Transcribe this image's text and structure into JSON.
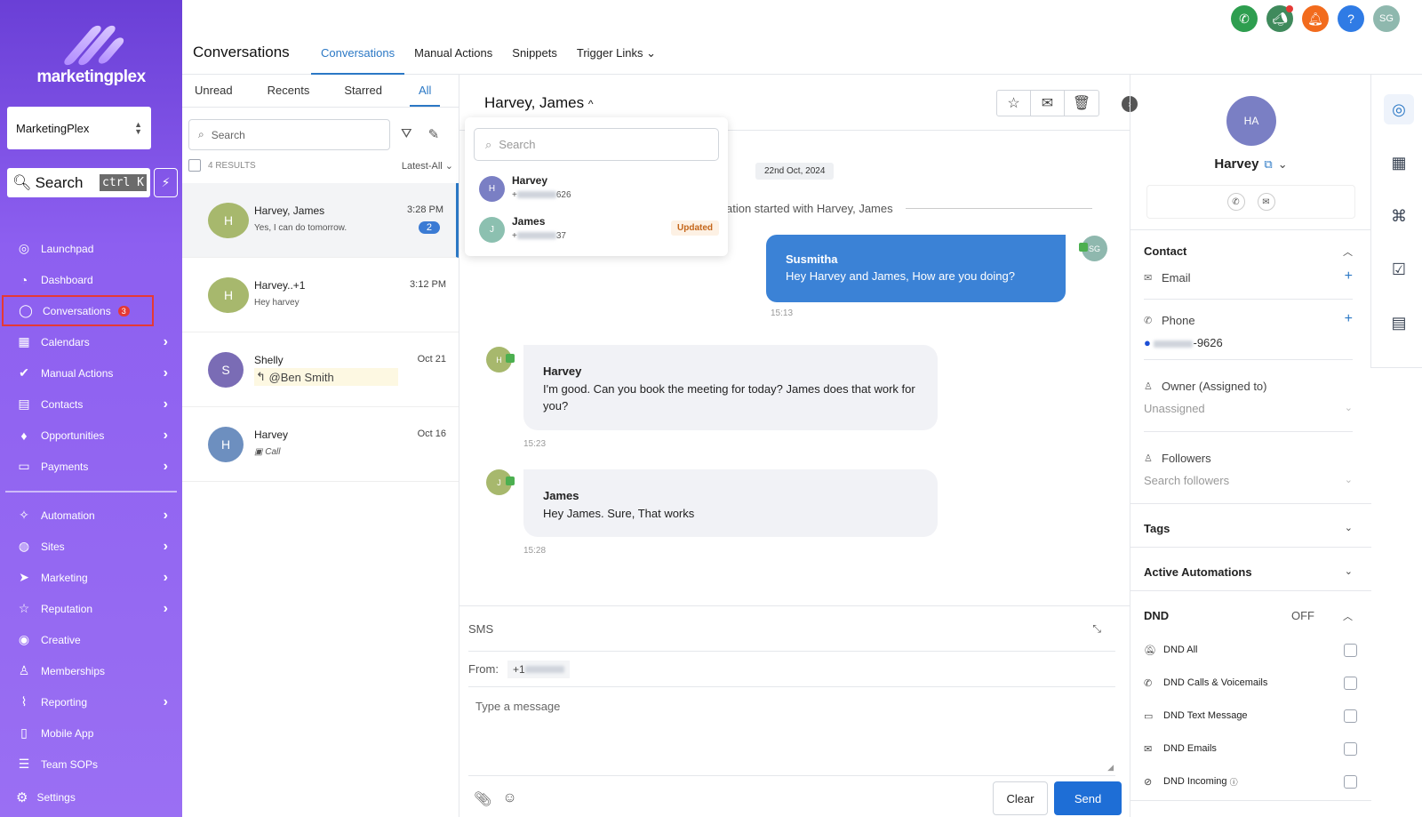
{
  "sidebar": {
    "brand": "marketingplex",
    "account": "MarketingPlex",
    "search_placeholder": "Search",
    "search_shortcut": "ctrl K",
    "items": [
      {
        "label": "Launchpad",
        "icon": "rocket-icon"
      },
      {
        "label": "Dashboard",
        "icon": "dashboard-icon"
      },
      {
        "label": "Conversations",
        "icon": "chat-icon",
        "badge": "3"
      },
      {
        "label": "Calendars",
        "icon": "calendar-icon"
      },
      {
        "label": "Manual Actions",
        "icon": "check-circle-icon"
      },
      {
        "label": "Contacts",
        "icon": "contact-book-icon"
      },
      {
        "label": "Opportunities",
        "icon": "fire-icon"
      },
      {
        "label": "Payments",
        "icon": "card-icon"
      },
      {
        "label": "Automation",
        "icon": "wand-icon"
      },
      {
        "label": "Sites",
        "icon": "globe-icon"
      },
      {
        "label": "Marketing",
        "icon": "send-icon"
      },
      {
        "label": "Reputation",
        "icon": "star-icon"
      },
      {
        "label": "Creative",
        "icon": "palette-icon"
      },
      {
        "label": "Memberships",
        "icon": "badge-icon"
      },
      {
        "label": "Reporting",
        "icon": "chart-icon"
      },
      {
        "label": "Mobile App",
        "icon": "phone-icon"
      },
      {
        "label": "Team SOPs",
        "icon": "list-icon"
      }
    ],
    "settings": "Settings"
  },
  "header": {
    "title": "Conversations",
    "tabs": [
      "Conversations",
      "Manual Actions",
      "Snippets",
      "Trigger Links"
    ],
    "user_initials": "SG"
  },
  "list": {
    "tabs": [
      "Unread",
      "Recents",
      "Starred",
      "All"
    ],
    "search_placeholder": "Search",
    "results": "4 RESULTS",
    "sort": "Latest-All",
    "conversations": [
      {
        "initial": "H",
        "name": "Harvey, James",
        "preview": "Yes, I can do tomorrow.",
        "time": "3:28 PM",
        "unread": "2"
      },
      {
        "initial": "H",
        "name": "Harvey..+1",
        "preview": "Hey harvey",
        "time": "3:12 PM"
      },
      {
        "initial": "S",
        "name": "Shelly",
        "preview": "@Ben Smith",
        "time": "Oct 21"
      },
      {
        "initial": "H",
        "name": "Harvey",
        "preview": "Call",
        "time": "Oct 16"
      }
    ]
  },
  "chat": {
    "title": "Harvey, James",
    "date": "22nd Oct, 2024",
    "started": "ation started with Harvey, James",
    "messages": [
      {
        "sender": "Susmitha",
        "text": "Hey Harvey and James, How are you doing?",
        "time": "15:13",
        "initials": "SG"
      },
      {
        "sender": "Harvey",
        "text": "I'm good. Can you book the meeting for today? James does that work for you?",
        "time": "15:23",
        "initials": "H"
      },
      {
        "sender": "James",
        "text": "Hey James. Sure, That works",
        "time": "15:28",
        "initials": "J"
      }
    ],
    "dropdown": {
      "search_placeholder": "Search",
      "participants": [
        {
          "initial": "H",
          "name": "Harvey",
          "phone_prefix": "+",
          "phone_suffix": "626"
        },
        {
          "initial": "J",
          "name": "James",
          "phone_prefix": "+",
          "phone_suffix": "37",
          "tag": "Updated"
        }
      ]
    },
    "composer": {
      "channel": "SMS",
      "from_label": "From:",
      "from_value": "+1",
      "placeholder": "Type a message",
      "clear": "Clear",
      "send": "Send"
    }
  },
  "contact": {
    "initials": "HA",
    "name": "Harvey",
    "section_contact": "Contact",
    "email_label": "Email",
    "phone_label": "Phone",
    "phone_value": "-9626",
    "owner_label": "Owner (Assigned to)",
    "owner_value": "Unassigned",
    "followers_label": "Followers",
    "followers_placeholder": "Search followers",
    "tags": "Tags",
    "active_automations": "Active Automations",
    "dnd": "DND",
    "dnd_state": "OFF",
    "dnd_items": [
      "DND All",
      "DND Calls & Voicemails",
      "DND Text Message",
      "DND Emails",
      "DND Incoming"
    ]
  },
  "colors": {
    "sidebar_top": "#6a3fd6",
    "accent": "#2b78c5",
    "send": "#1e6ed6",
    "outgoing_bubble": "#3b82d6",
    "badge_red": "#e53935"
  }
}
